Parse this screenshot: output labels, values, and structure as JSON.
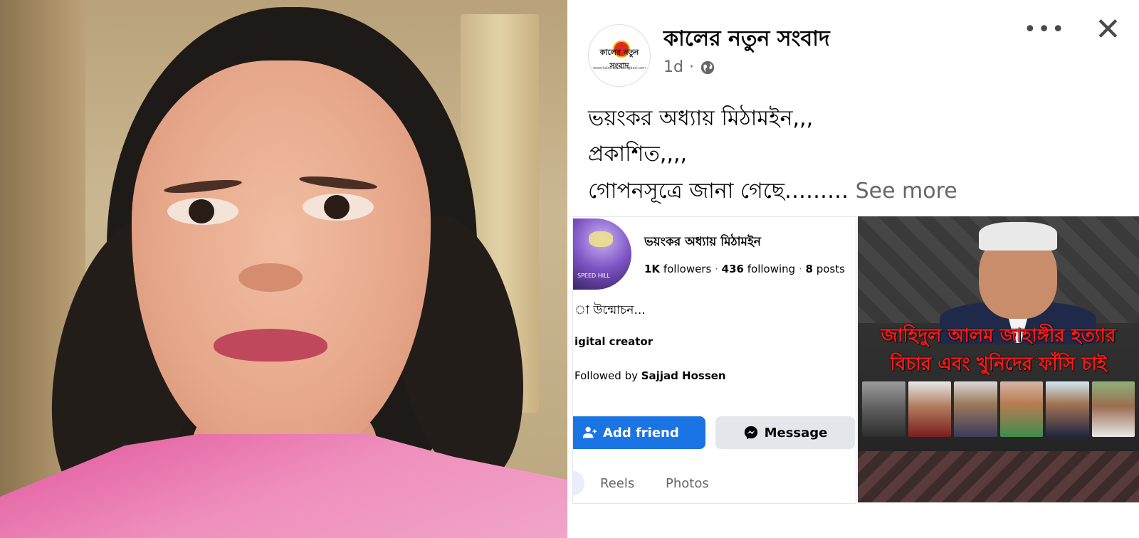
{
  "post": {
    "page_name": "কালের নতুন সংবাদ",
    "logo_text": "কালের নতুন সংবাদ",
    "logo_url": "www.kalernatunsongbad.com",
    "time": "1d",
    "separator": "·",
    "more_label": "•••",
    "close_label": "✕",
    "lines": [
      "ভয়ংকর অধ্যায় মিঠামইন,,,",
      "প্রকাশিত,,,,",
      "গোপনসূত্রে জানা গেছে………"
    ],
    "see_more": "See more"
  },
  "profile_card": {
    "name": "ভয়ংকর অধ্যায় মিঠামইন",
    "avatar_tag": "SPEED HILL",
    "followers": "1K",
    "followers_label": "followers",
    "following": "436",
    "following_label": "following",
    "posts": "8",
    "posts_label": "posts",
    "dot": "·",
    "bio": "া উন্মোচন...",
    "role": "igital creator",
    "followed_by_label": "Followed by",
    "followed_by_name": "Sajjad Hossen",
    "add_friend_label": "Add friend",
    "message_label": "Message",
    "tabs": [
      "Reels",
      "Photos"
    ]
  },
  "banner": {
    "headline_line1": "জাহিদুল আলম জাহাঙ্গীর হত্যার",
    "headline_line2": "বিচার এবং খুনিদের ফাঁসি চাই"
  },
  "colors": {
    "facebook_blue": "#1b74e4",
    "muted_text": "#65676b",
    "headline_red": "#ff1a1a"
  }
}
